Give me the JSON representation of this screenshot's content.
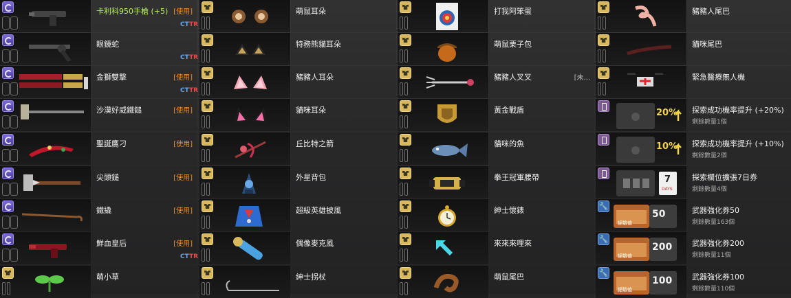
{
  "columns": [
    {
      "items": [
        {
          "name": "卡利科950手槍 (+5)",
          "action": "[使用]",
          "ct": "CT",
          "tr": "TR",
          "icon": "weapon-icon",
          "art": "pistol"
        },
        {
          "name": "眼鏡蛇",
          "action": "",
          "ct": "CT",
          "tr": "TR",
          "icon": "weapon-icon",
          "art": "revolver"
        },
        {
          "name": "金獅雙擊",
          "action": "[使用]",
          "ct": "CT",
          "tr": "TR",
          "icon": "weapon-icon",
          "art": "dual-guns"
        },
        {
          "name": "沙漠好威鐵鎚",
          "action": "[使用]",
          "ct": "",
          "tr": "",
          "icon": "weapon-icon",
          "art": "hammer"
        },
        {
          "name": "聖誕鷹刁",
          "action": "[使用]",
          "ct": "",
          "tr": "",
          "icon": "weapon-icon",
          "art": "christmas-blade"
        },
        {
          "name": "尖頭鎚",
          "action": "[使用]",
          "ct": "",
          "tr": "",
          "icon": "weapon-icon",
          "art": "spike-hammer"
        },
        {
          "name": "鐵撬",
          "action": "[使用]",
          "ct": "",
          "tr": "",
          "icon": "weapon-icon",
          "art": "crowbar"
        },
        {
          "name": "鮮血皇后",
          "action": "[使用]",
          "ct": "CT",
          "tr": "TR",
          "icon": "weapon-icon",
          "art": "red-gun"
        },
        {
          "name": "萌小草",
          "action": "",
          "ct": "",
          "tr": "",
          "icon": "costume-icon",
          "art": "sprout"
        }
      ]
    },
    {
      "items": [
        {
          "name": "萌鼠耳朵",
          "icon": "costume-icon",
          "art": "mouse-ears"
        },
        {
          "name": "特務熊貓耳朵",
          "icon": "costume-icon",
          "art": "panda-ears"
        },
        {
          "name": "豬豬人耳朵",
          "icon": "costume-icon",
          "art": "pig-ears"
        },
        {
          "name": "貓咪耳朵",
          "icon": "costume-icon",
          "art": "cat-ears"
        },
        {
          "name": "丘比特之箭",
          "icon": "costume-icon",
          "art": "cupid-arrow"
        },
        {
          "name": "外星背包",
          "icon": "costume-icon",
          "art": "alien-bag"
        },
        {
          "name": "超級英雄披風",
          "icon": "costume-icon",
          "art": "hero-cape"
        },
        {
          "name": "偶像麥克風",
          "icon": "costume-icon",
          "art": "microphone"
        },
        {
          "name": "紳士拐杖",
          "icon": "costume-icon",
          "art": "cane"
        }
      ]
    },
    {
      "items": [
        {
          "name": "打我阿笨蛋",
          "icon": "costume-icon",
          "art": "target"
        },
        {
          "name": "萌鼠栗子包",
          "icon": "costume-icon",
          "art": "acorn"
        },
        {
          "name": "豬豬人叉叉",
          "extra": "[未...",
          "icon": "costume-icon",
          "art": "fork"
        },
        {
          "name": "黃金戰盾",
          "icon": "costume-icon",
          "art": "gold-shield"
        },
        {
          "name": "貓咪的魚",
          "icon": "costume-icon",
          "art": "fish"
        },
        {
          "name": "拳王冠軍腰帶",
          "icon": "costume-icon",
          "art": "belt"
        },
        {
          "name": "紳士懷錶",
          "icon": "costume-icon",
          "art": "watch"
        },
        {
          "name": "來來來哩來",
          "icon": "costume-icon",
          "art": "arrow"
        },
        {
          "name": "萌鼠尾巴",
          "icon": "costume-icon",
          "art": "mouse-tail"
        }
      ]
    },
    {
      "items": [
        {
          "name": "豬豬人尾巴",
          "sub": "",
          "icon": "costume-icon",
          "art": "pig-tail"
        },
        {
          "name": "貓咪尾巴",
          "sub": "",
          "icon": "costume-icon",
          "art": "cat-tail"
        },
        {
          "name": "緊急醫療無人機",
          "sub": "",
          "icon": "costume-icon",
          "art": "drone"
        },
        {
          "name": "探索成功機率提升 (+20%)",
          "sub": "剩餘數量1個",
          "icon": "ticket-icon",
          "art": "boost",
          "badge": "20%"
        },
        {
          "name": "探索成功機率提升 (+10%)",
          "sub": "剩餘數量2個",
          "icon": "ticket-icon",
          "art": "boost",
          "badge": "10%"
        },
        {
          "name": "探索欄位擴張7日券",
          "sub": "剩餘數量4個",
          "icon": "ticket-icon",
          "art": "slots",
          "badge": "7"
        },
        {
          "name": "武器強化券50",
          "sub": "剩餘數量163個",
          "icon": "wrench-icon",
          "art": "box",
          "badge": "50"
        },
        {
          "name": "武器強化券200",
          "sub": "剩餘數量11個",
          "icon": "wrench-icon",
          "art": "box",
          "badge": "200"
        },
        {
          "name": "武器強化券100",
          "sub": "剩餘數量110個",
          "icon": "wrench-icon",
          "art": "box",
          "badge": "100"
        }
      ]
    }
  ],
  "badge_caption": "DAYS",
  "box_caption": "經驗值"
}
